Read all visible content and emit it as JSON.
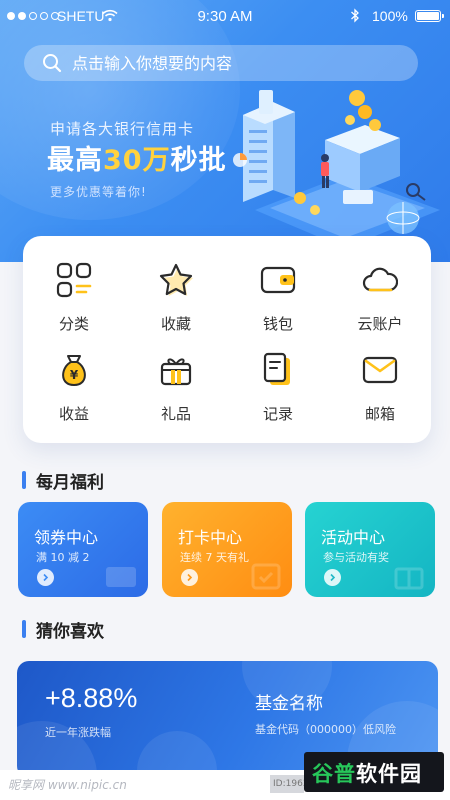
{
  "status_bar": {
    "carrier": "SHETU",
    "time": "9:30 AM",
    "battery": "100%"
  },
  "search": {
    "placeholder": "点击输入你想要的内容"
  },
  "banner": {
    "line1": "申请各大银行信用卡",
    "headline_prefix": "最高",
    "headline_highlight": "30万",
    "headline_suffix": "秒批",
    "line3": "更多优惠等着你!"
  },
  "grid": [
    {
      "label": "分类",
      "icon": "category-icon"
    },
    {
      "label": "收藏",
      "icon": "star-icon"
    },
    {
      "label": "钱包",
      "icon": "wallet-icon"
    },
    {
      "label": "云账户",
      "icon": "cloud-icon"
    },
    {
      "label": "收益",
      "icon": "money-bag-icon"
    },
    {
      "label": "礼品",
      "icon": "gift-icon"
    },
    {
      "label": "记录",
      "icon": "record-icon"
    },
    {
      "label": "邮箱",
      "icon": "mail-icon"
    }
  ],
  "sections": {
    "monthly": "每月福利",
    "guess": "猜你喜欢"
  },
  "benefits": [
    {
      "title": "领券中心",
      "sub": "满 10 减 2",
      "color": "#3c8cf5"
    },
    {
      "title": "打卡中心",
      "sub": "连续 7 天有礼",
      "color": "#ffa21f"
    },
    {
      "title": "活动中心",
      "sub": "参与活动有奖",
      "color": "#1fc4cb"
    }
  ],
  "fund": {
    "rate": "+8.88%",
    "rate_label": "近一年涨跌幅",
    "name": "基金名称",
    "code": "基金代码（000000）低风险"
  },
  "footer": {
    "watermark": "昵享网 www.nipic.cn",
    "id_text": "ID:1963",
    "brand_a": "谷普",
    "brand_b": "软件园"
  },
  "colors": {
    "accent": "#3a7ff0",
    "highlight": "#ffd23e",
    "icon_yellow": "#ffc21a"
  }
}
